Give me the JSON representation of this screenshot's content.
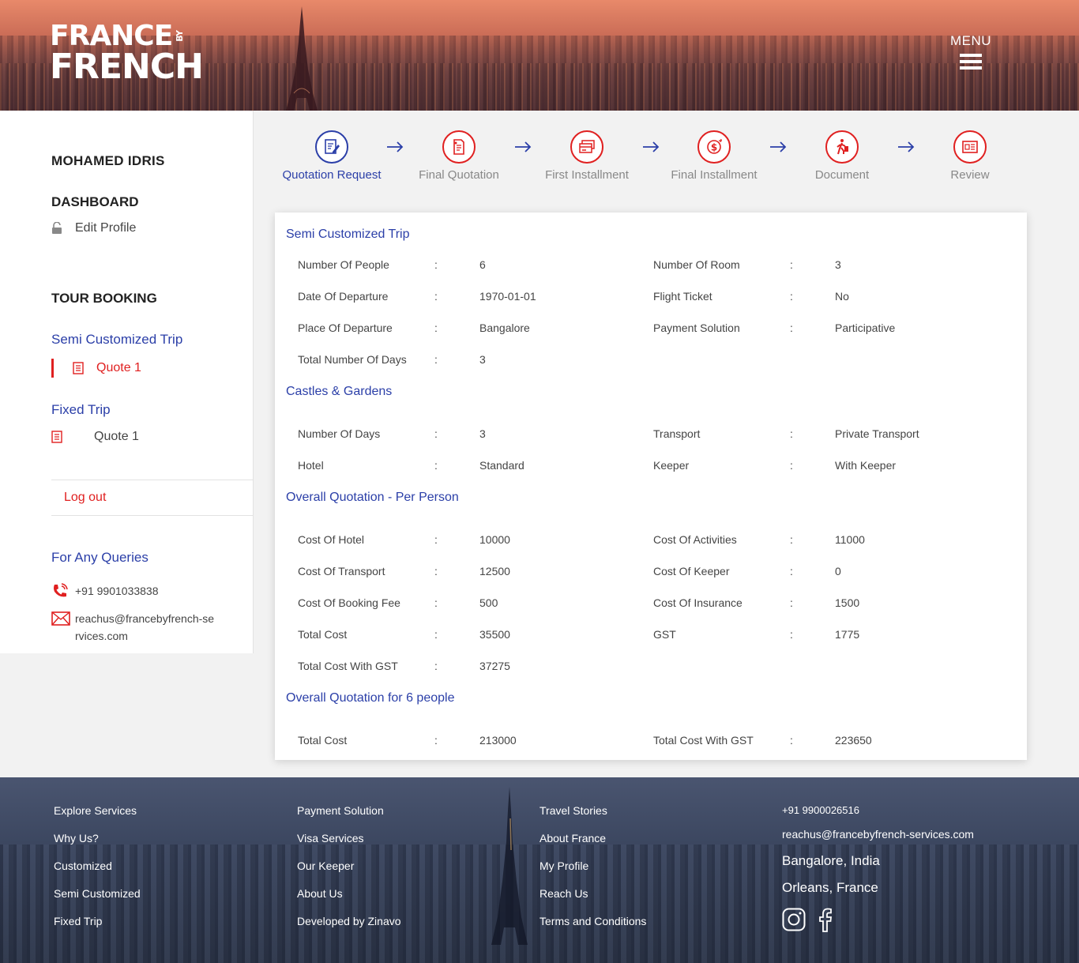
{
  "header": {
    "logo_line1": "FRANCE",
    "logo_by": "BY",
    "logo_line2": "FRENCH",
    "menu_label": "MENU"
  },
  "sidebar": {
    "user_name": "MOHAMED IDRIS",
    "dashboard_heading": "DASHBOARD",
    "edit_profile": "Edit Profile",
    "tour_booking_heading": "TOUR BOOKING",
    "semi_customized_label": "Semi Customized Trip",
    "semi_quote": "Quote 1",
    "fixed_trip_label": "Fixed Trip",
    "fixed_quote": "Quote 1",
    "logout": "Log out",
    "queries_heading": "For Any Queries",
    "phone": "+91 9901033838",
    "email": "reachus@francebyfrench-services.com"
  },
  "steps": [
    {
      "label": "Quotation Request",
      "icon": "edit-document-icon",
      "active": true
    },
    {
      "label": "Final Quotation",
      "icon": "quotation-icon",
      "active": false
    },
    {
      "label": "First Installment",
      "icon": "cards-icon",
      "active": false
    },
    {
      "label": "Final Installment",
      "icon": "dollar-icon",
      "active": false
    },
    {
      "label": "Document",
      "icon": "traveller-icon",
      "active": false
    },
    {
      "label": "Review",
      "icon": "review-icon",
      "active": false
    }
  ],
  "trip": {
    "title": "Semi Customized Trip",
    "rows": [
      {
        "l1": "Number Of People",
        "v1": "6",
        "l2": "Number Of Room",
        "v2": "3"
      },
      {
        "l1": "Date Of Departure",
        "v1": "1970-01-01",
        "l2": "Flight Ticket",
        "v2": "No"
      },
      {
        "l1": "Place Of Departure",
        "v1": "Bangalore",
        "l2": "Payment Solution",
        "v2": "Participative"
      },
      {
        "l1": "Total Number Of Days",
        "v1": "3",
        "l2": "",
        "v2": ""
      }
    ]
  },
  "castles": {
    "title": "Castles & Gardens",
    "rows": [
      {
        "l1": "Number Of Days",
        "v1": "3",
        "l2": "Transport",
        "v2": "Private Transport"
      },
      {
        "l1": "Hotel",
        "v1": "Standard",
        "l2": "Keeper",
        "v2": "With Keeper"
      }
    ]
  },
  "per_person": {
    "title": "Overall Quotation - Per Person",
    "rows": [
      {
        "l1": "Cost Of Hotel",
        "v1": "10000",
        "l2": "Cost Of Activities",
        "v2": "11000"
      },
      {
        "l1": "Cost Of Transport",
        "v1": "12500",
        "l2": "Cost Of Keeper",
        "v2": "0"
      },
      {
        "l1": "Cost Of Booking Fee",
        "v1": "500",
        "l2": "Cost Of Insurance",
        "v2": "1500"
      },
      {
        "l1": "Total Cost",
        "v1": "35500",
        "l2": "GST",
        "v2": "1775"
      },
      {
        "l1": "Total Cost With GST",
        "v1": "37275",
        "l2": "",
        "v2": ""
      }
    ]
  },
  "overall": {
    "title": "Overall Quotation for 6 people",
    "rows": [
      {
        "l1": "Total Cost",
        "v1": "213000",
        "l2": "Total Cost With GST",
        "v2": "223650"
      }
    ]
  },
  "colon": ":",
  "footer": {
    "col1": [
      "Explore Services",
      "Why Us?",
      "Customized",
      "Semi Customized",
      "Fixed Trip"
    ],
    "col2": [
      "Payment Solution",
      "Visa Services",
      "Our Keeper",
      "About Us",
      "Developed by Zinavo"
    ],
    "col3": [
      "Travel Stories",
      "About France",
      "My Profile",
      "Reach Us",
      "Terms and Conditions"
    ],
    "phone": "+91 9900026516",
    "email": "reachus@francebyfrench-services.com",
    "city1": "Bangalore, India",
    "city2": "Orleans, France"
  },
  "colors": {
    "primary_blue": "#2b3fa8",
    "accent_red": "#e02020"
  }
}
